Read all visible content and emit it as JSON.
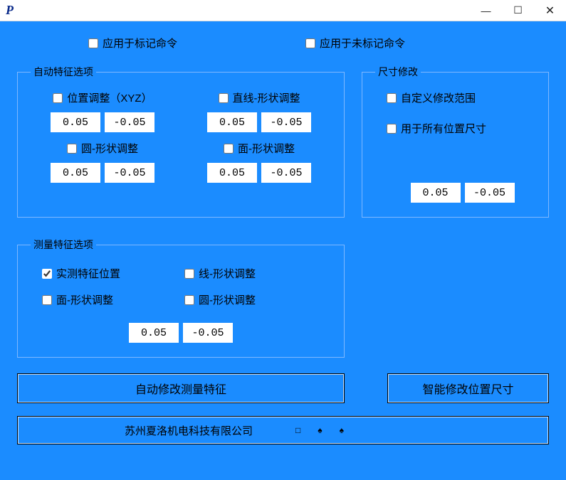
{
  "titlebar": {
    "icon_letter": "P",
    "minimize": "—",
    "maximize": "☐",
    "close": "✕"
  },
  "top": {
    "apply_marked": "应用于标记命令",
    "apply_unmarked": "应用于未标记命令"
  },
  "auto_group": {
    "legend": "自动特征选项",
    "position": {
      "label": "位置调整（XYZ）",
      "pos": "0.05",
      "neg": "-0.05"
    },
    "line": {
      "label": "直线-形状调整",
      "pos": "0.05",
      "neg": "-0.05"
    },
    "circle": {
      "label": "圆-形状调整",
      "pos": "0.05",
      "neg": "-0.05"
    },
    "plane": {
      "label": "面-形状调整",
      "pos": "0.05",
      "neg": "-0.05"
    }
  },
  "size_group": {
    "legend": "尺寸修改",
    "custom_range": "自定义修改范围",
    "all_positions": "用于所有位置尺寸",
    "pos": "0.05",
    "neg": "-0.05"
  },
  "meas_group": {
    "legend": "测量特征选项",
    "measured_pos": "实测特征位置",
    "line": "线-形状调整",
    "plane": "面-形状调整",
    "circle": "圆-形状调整",
    "pos": "0.05",
    "neg": "-0.05"
  },
  "buttons": {
    "auto_modify": "自动修改测量特征",
    "smart_modify": "智能修改位置尺寸"
  },
  "footer": {
    "company": "苏州夏洛机电科技有限公司",
    "icon1": "□",
    "icon2": "♠",
    "icon3": "♠"
  }
}
